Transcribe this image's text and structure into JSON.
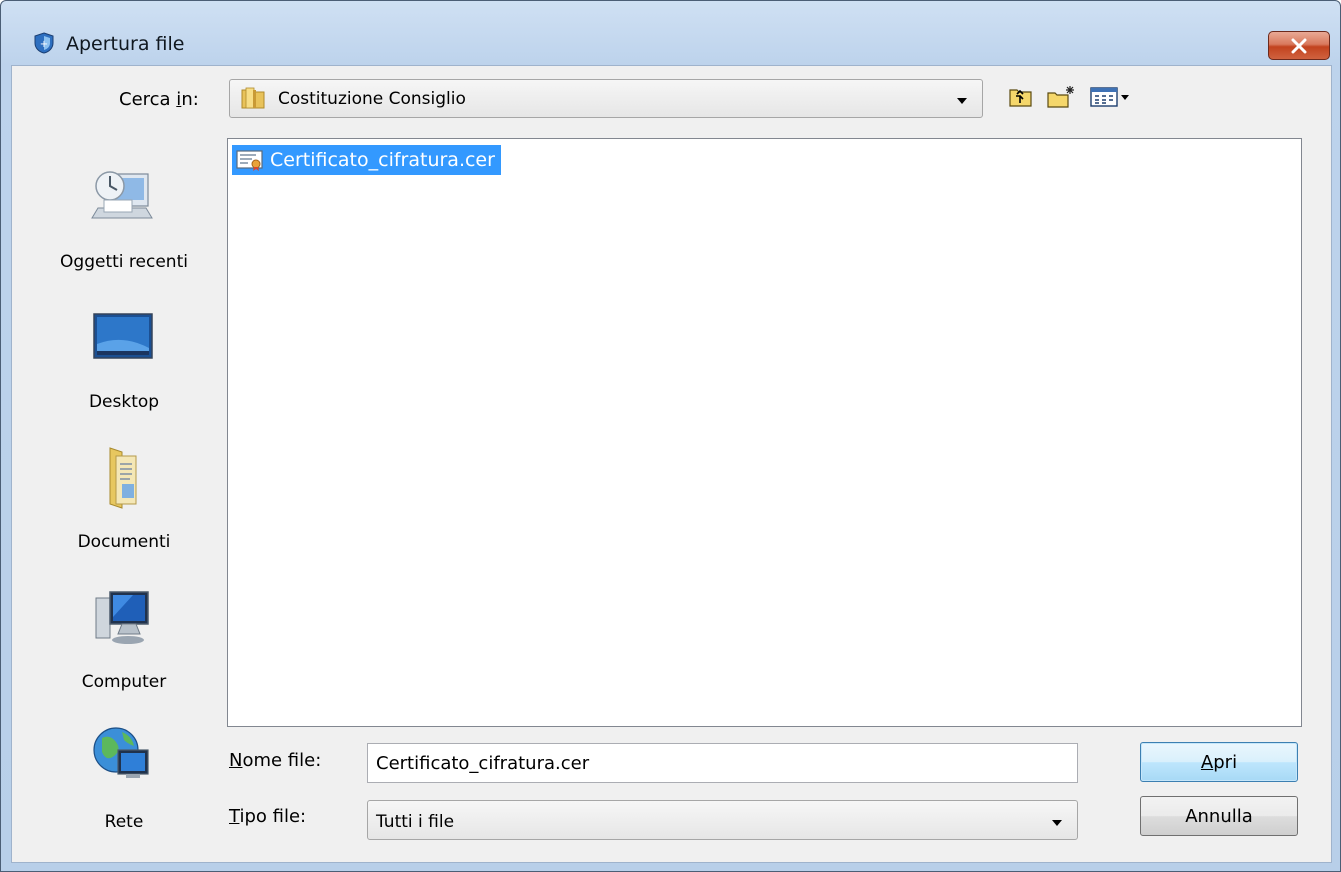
{
  "window": {
    "title": "Apertura file",
    "close_icon": "close-icon"
  },
  "lookin": {
    "label_prefix": "Cerca ",
    "label_accel": "i",
    "label_suffix": "n:",
    "value": "Costituzione Consiglio",
    "icon": "folder-icon"
  },
  "toolbar": {
    "up_icon": "up-one-level-icon",
    "new_folder_icon": "new-folder-icon",
    "view_menu_icon": "view-menu-icon"
  },
  "places": [
    {
      "label": "Oggetti recenti",
      "icon": "recent-items-icon"
    },
    {
      "label": "Desktop",
      "icon": "desktop-icon"
    },
    {
      "label": "Documenti",
      "icon": "documents-icon"
    },
    {
      "label": "Computer",
      "icon": "computer-icon"
    },
    {
      "label": "Rete",
      "icon": "network-icon"
    }
  ],
  "files": [
    {
      "name": "Certificato_cifratura.cer",
      "icon": "certificate-icon",
      "selected": true
    }
  ],
  "filename": {
    "label_accel": "N",
    "label_rest": "ome file:",
    "value": "Certificato_cifratura.cer"
  },
  "filetype": {
    "label_accel": "T",
    "label_rest": "ipo file:",
    "value": "Tutti i file"
  },
  "buttons": {
    "open_accel": "A",
    "open_rest": "pri",
    "cancel": "Annulla"
  },
  "colors": {
    "selection": "#3399ff",
    "close_button": "#c7472a"
  }
}
